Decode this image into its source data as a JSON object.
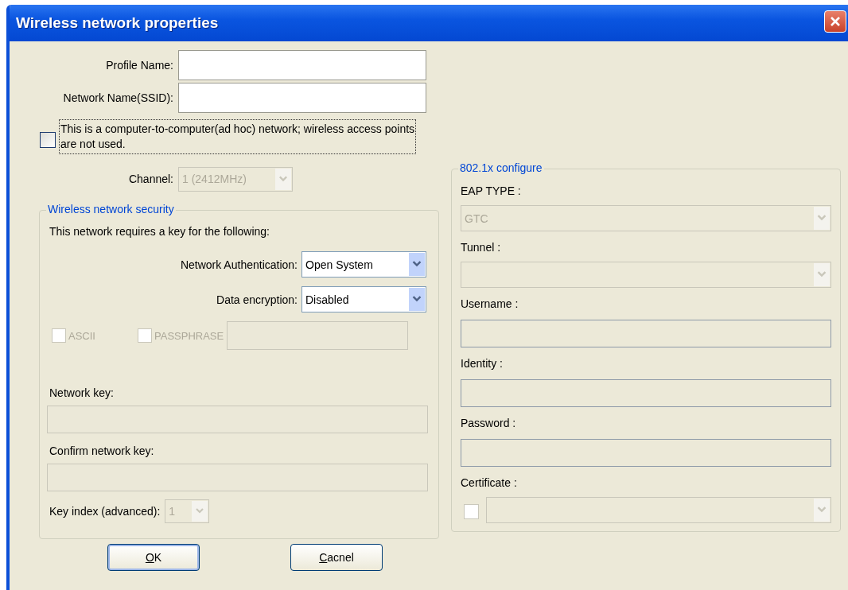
{
  "window": {
    "title": "Wireless network properties"
  },
  "fields": [
    {
      "label": "Profile Name:"
    },
    {
      "label": "Network Name(SSID):"
    }
  ],
  "adhoc": {
    "label": "This is a computer-to-computer(ad hoc) network; wireless access points are not used.",
    "checked": false,
    "focused": true
  },
  "channel": {
    "label": "Channel:",
    "value": "1  (2412MHz)",
    "disabled": true
  },
  "security": {
    "legend": "Wireless network security",
    "intro": "This network requires a key for the following:",
    "selects": [
      {
        "label": "Network Authentication:",
        "value": "Open System",
        "disabled": false
      },
      {
        "label": "Data encryption:",
        "value": "Disabled",
        "disabled": false
      }
    ],
    "checks": [
      {
        "label": "ASCII",
        "checked": false,
        "disabled": true
      },
      {
        "label": "PASSPHRASE",
        "checked": false,
        "disabled": true
      }
    ],
    "passphrase_field": {
      "disabled": true
    },
    "key_fields": [
      {
        "label": "Network key:",
        "disabled": true
      },
      {
        "label": "Confirm network key:",
        "disabled": true
      }
    ],
    "key_index": {
      "label": "Key index (advanced):",
      "value": "1",
      "disabled": true
    }
  },
  "eap": {
    "legend": "802.1x configure",
    "items": [
      {
        "kind": "select",
        "label": "EAP TYPE :",
        "value": "GTC",
        "disabled": true
      },
      {
        "kind": "select",
        "label": "Tunnel :",
        "disabled": true
      },
      {
        "kind": "input",
        "label": "Username :",
        "disabled": true
      },
      {
        "kind": "input",
        "label": "Identity :",
        "disabled": true
      },
      {
        "kind": "input",
        "label": "Password :",
        "disabled": true
      },
      {
        "kind": "checkselect",
        "label": "Certificate :",
        "checked": false,
        "disabled": true
      }
    ]
  },
  "buttons": [
    {
      "label": "OK",
      "default": true,
      "mnemonic": true
    },
    {
      "label": "Cacnel",
      "default": false,
      "mnemonic": true
    }
  ]
}
